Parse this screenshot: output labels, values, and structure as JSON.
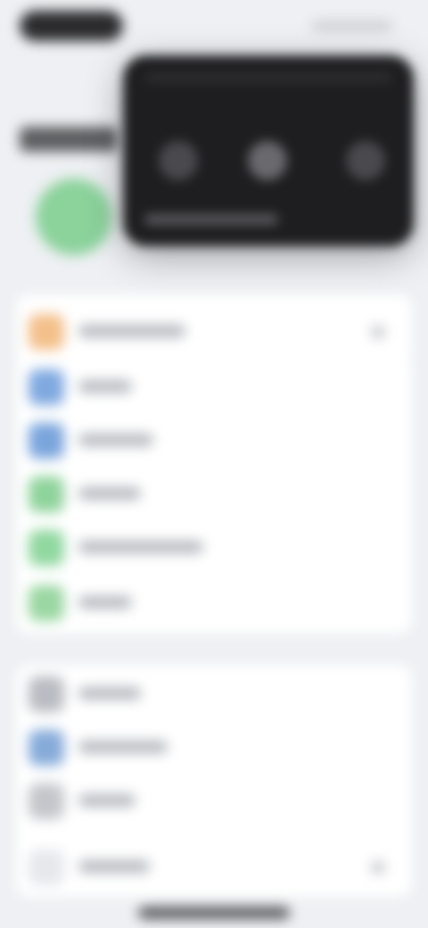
{
  "colors": {
    "background": "#eef0f3",
    "card": "#ffffff",
    "overlay": "#1e1e20",
    "avatar": "#8bd29b"
  },
  "header": {
    "avatar_icon": "avatar"
  },
  "overlay": {
    "controls": [
      {
        "icon": "previous-icon"
      },
      {
        "icon": "play-pause-icon"
      },
      {
        "icon": "next-icon"
      }
    ]
  },
  "settings_rows": [
    {
      "icon": "orange-app-icon",
      "color": "#f3c08a"
    },
    {
      "icon": "blue-app-icon",
      "color": "#7fa9e0"
    },
    {
      "icon": "blue-app-icon",
      "color": "#7aa5dc"
    },
    {
      "icon": "green-app-icon",
      "color": "#8fd39c"
    },
    {
      "icon": "green-app-icon",
      "color": "#90d8a0"
    },
    {
      "icon": "green-app-icon",
      "color": "#9ad7a2"
    },
    {
      "icon": "gray-app-icon",
      "color": "#b9bcc2"
    },
    {
      "icon": "blue-app-icon",
      "color": "#86abd9"
    },
    {
      "icon": "gray-app-icon",
      "color": "#c4c6cb"
    },
    {
      "icon": "white-app-icon",
      "color": "#e6e8ec"
    }
  ]
}
